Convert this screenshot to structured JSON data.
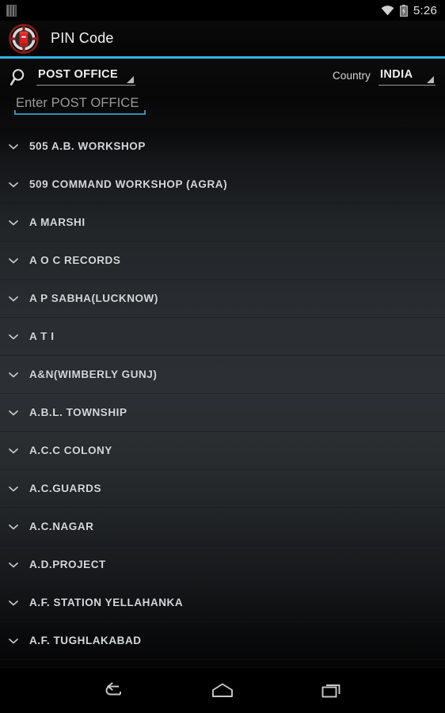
{
  "status_bar": {
    "left_icon": "sim-card-icon",
    "wifi_icon": "wifi-icon",
    "battery_icon": "battery-charging-icon",
    "time": "5:26"
  },
  "action_bar": {
    "logo_icon": "post-box-logo-icon",
    "title": "PIN Code",
    "accent_color": "#33b5e5"
  },
  "filter_bar": {
    "search_icon": "search-icon",
    "category_spinner": {
      "value": "POST OFFICE",
      "dropdown_icon": "dropdown-triangle-icon"
    },
    "country_label": "Country",
    "country_spinner": {
      "value": "INDIA",
      "dropdown_icon": "dropdown-triangle-icon"
    },
    "search_input": {
      "value": "",
      "placeholder": "Enter POST OFFICE",
      "underline_color": "#2d8fb5"
    }
  },
  "list": {
    "item_icon": "chevron-down-icon",
    "items": [
      {
        "label": "505 A.B. WORKSHOP"
      },
      {
        "label": "509 COMMAND WORKSHOP (AGRA)"
      },
      {
        "label": "A MARSHI"
      },
      {
        "label": "A O C  RECORDS"
      },
      {
        "label": "A P SABHA(LUCKNOW)"
      },
      {
        "label": "A T I"
      },
      {
        "label": "A&N(WIMBERLY GUNJ)"
      },
      {
        "label": "A.B.L. TOWNSHIP"
      },
      {
        "label": "A.C.C COLONY"
      },
      {
        "label": "A.C.GUARDS"
      },
      {
        "label": "A.C.NAGAR"
      },
      {
        "label": "A.D.PROJECT"
      },
      {
        "label": "A.F. STATION YELLAHANKA"
      },
      {
        "label": "A.F. TUGHLAKABAD"
      }
    ]
  },
  "nav_bar": {
    "back_icon": "back-arrow-icon",
    "home_icon": "home-icon",
    "recents_icon": "recents-icon"
  }
}
